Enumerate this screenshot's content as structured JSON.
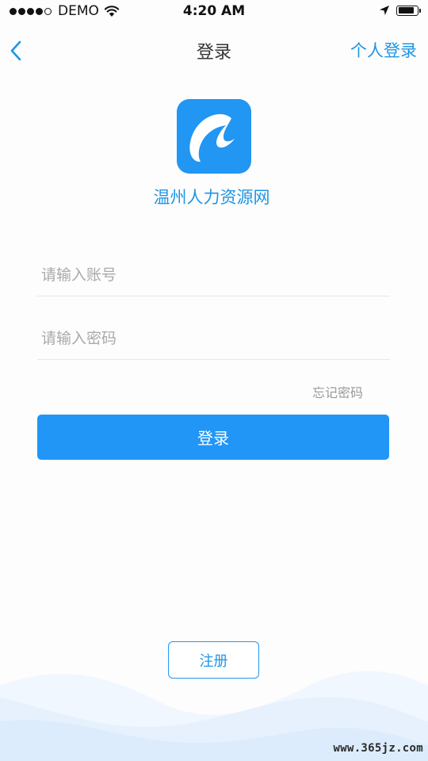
{
  "status_bar": {
    "carrier": "DEMO",
    "time": "4:20 AM",
    "signal_strength": 4,
    "signal_max": 5,
    "battery_level": 0.85
  },
  "nav": {
    "title": "登录",
    "right_label": "个人登录",
    "back_icon": "chevron-left-icon"
  },
  "brand": {
    "app_name": "温州人力资源网",
    "logo_icon": "wave-c-logo"
  },
  "form": {
    "account_placeholder": "请输入账号",
    "account_value": "",
    "password_placeholder": "请输入密码",
    "password_value": "",
    "forgot_label": "忘记密码",
    "login_label": "登录",
    "register_label": "注册"
  },
  "watermark": "www.365jz.com",
  "colors": {
    "accent": "#2196f6",
    "link": "#1e95e6",
    "placeholder": "#a9a9a9",
    "background": "#fdfdfd"
  }
}
